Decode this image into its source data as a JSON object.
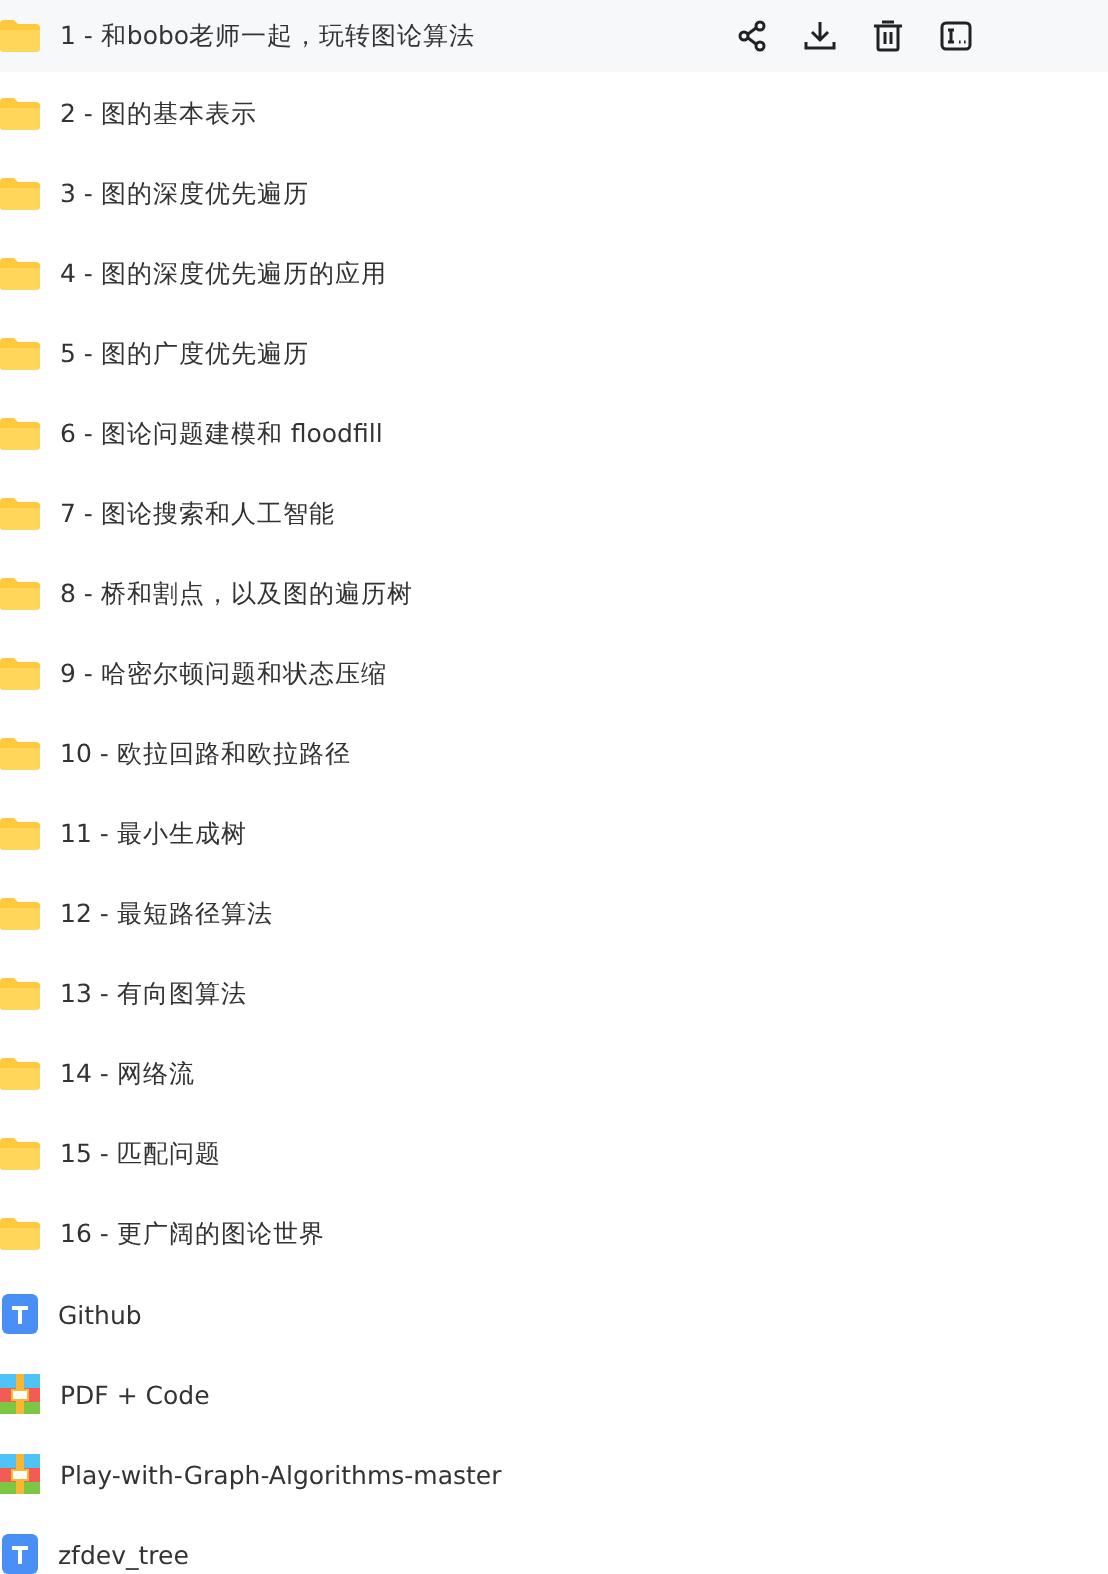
{
  "files": [
    {
      "name": "1 - 和bobo老师一起，玩转图论算法",
      "kind": "folder",
      "selected": true
    },
    {
      "name": "2 - 图的基本表示",
      "kind": "folder",
      "selected": false
    },
    {
      "name": "3 - 图的深度优先遍历",
      "kind": "folder",
      "selected": false
    },
    {
      "name": "4 - 图的深度优先遍历的应用",
      "kind": "folder",
      "selected": false
    },
    {
      "name": "5 - 图的广度优先遍历",
      "kind": "folder",
      "selected": false
    },
    {
      "name": "6 - 图论问题建模和 floodfill",
      "kind": "folder",
      "selected": false
    },
    {
      "name": "7 - 图论搜索和人工智能",
      "kind": "folder",
      "selected": false
    },
    {
      "name": "8 - 桥和割点，以及图的遍历树",
      "kind": "folder",
      "selected": false
    },
    {
      "name": "9 - 哈密尔顿问题和状态压缩",
      "kind": "folder",
      "selected": false
    },
    {
      "name": "10 - 欧拉回路和欧拉路径",
      "kind": "folder",
      "selected": false
    },
    {
      "name": "11 - 最小生成树",
      "kind": "folder",
      "selected": false
    },
    {
      "name": "12 - 最短路径算法",
      "kind": "folder",
      "selected": false
    },
    {
      "name": "13 - 有向图算法",
      "kind": "folder",
      "selected": false
    },
    {
      "name": "14 - 网络流",
      "kind": "folder",
      "selected": false
    },
    {
      "name": "15 - 匹配问题",
      "kind": "folder",
      "selected": false
    },
    {
      "name": "16 - 更广阔的图论世界",
      "kind": "folder",
      "selected": false
    },
    {
      "name": "Github",
      "kind": "doc",
      "selected": false
    },
    {
      "name": "PDF + Code",
      "kind": "archive",
      "selected": false
    },
    {
      "name": "Play-with-Graph-Algorithms-master",
      "kind": "archive",
      "selected": false
    },
    {
      "name": "zfdev_tree",
      "kind": "doc",
      "selected": false
    }
  ]
}
